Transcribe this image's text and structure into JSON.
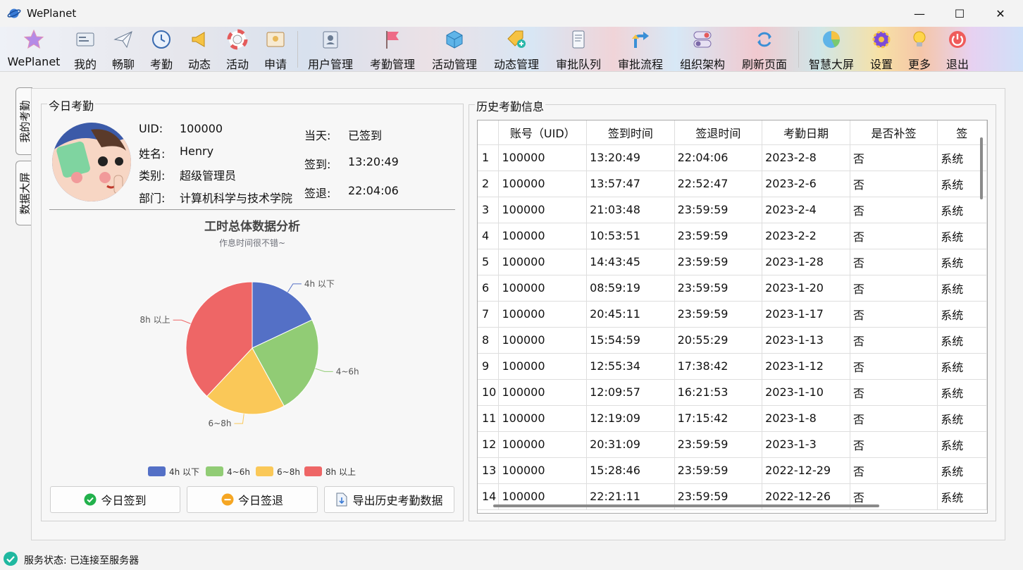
{
  "window": {
    "title": "WePlanet",
    "minimize_glyph": "—",
    "maximize_glyph": "☐",
    "close_glyph": "✕"
  },
  "toolbar": {
    "items": [
      {
        "label": "WePlanet",
        "icon": "star-icon"
      },
      {
        "label": "我的",
        "icon": "id-card-icon"
      },
      {
        "label": "畅聊",
        "icon": "paper-plane-icon"
      },
      {
        "label": "考勤",
        "icon": "clock-icon"
      },
      {
        "label": "动态",
        "icon": "megaphone-icon"
      },
      {
        "label": "活动",
        "icon": "lifebuoy-icon"
      },
      {
        "label": "申请",
        "icon": "certificate-icon"
      },
      {
        "label": "用户管理",
        "icon": "user-book-icon"
      },
      {
        "label": "考勤管理",
        "icon": "flag-icon"
      },
      {
        "label": "活动管理",
        "icon": "cube-icon"
      },
      {
        "label": "动态管理",
        "icon": "tag-plus-icon"
      },
      {
        "label": "审批队列",
        "icon": "scroll-icon"
      },
      {
        "label": "审批流程",
        "icon": "branch-arrow-icon"
      },
      {
        "label": "组织架构",
        "icon": "toggle-icon"
      },
      {
        "label": "刷新页面",
        "icon": "refresh-icon"
      },
      {
        "label": "智慧大屏",
        "icon": "dashboard-pie-icon"
      },
      {
        "label": "设置",
        "icon": "gear-icon"
      },
      {
        "label": "更多",
        "icon": "lightbulb-icon"
      },
      {
        "label": "退出",
        "icon": "power-icon"
      }
    ]
  },
  "side_tabs": [
    "我的考勤",
    "数据大屏"
  ],
  "today": {
    "group_title": "今日考勤",
    "uid_label": "UID:",
    "uid_value": "100000",
    "name_label": "姓名:",
    "name_value": "Henry",
    "type_label": "类别:",
    "type_value": "超级管理员",
    "dept_label": "部门:",
    "dept_value": "计算机科学与技术学院",
    "day_label": "当天:",
    "day_value": "已签到",
    "signin_label": "签到:",
    "signin_value": "13:20:49",
    "signout_label": "签退:",
    "signout_value": "22:04:06"
  },
  "chart_data": {
    "type": "pie",
    "title": "工时总体数据分析",
    "subtitle": "作息时间很不错~",
    "categories": [
      "4h 以下",
      "4~6h",
      "6~8h",
      "8h 以上"
    ],
    "values": [
      18,
      24,
      20,
      38
    ],
    "colors": [
      "#5470c6",
      "#91cc75",
      "#fac858",
      "#ee6666"
    ],
    "legend_position": "bottom"
  },
  "buttons": {
    "checkin": "今日签到",
    "checkout": "今日签退",
    "export": "导出历史考勤数据"
  },
  "history": {
    "group_title": "历史考勤信息",
    "columns": [
      "账号（UID）",
      "签到时间",
      "签退时间",
      "考勤日期",
      "是否补签",
      "签"
    ],
    "rows": [
      [
        "1",
        "100000",
        "13:20:49",
        "22:04:06",
        "2023-2-8",
        "否",
        "系统"
      ],
      [
        "2",
        "100000",
        "13:57:47",
        "22:52:47",
        "2023-2-6",
        "否",
        "系统"
      ],
      [
        "3",
        "100000",
        "21:03:48",
        "23:59:59",
        "2023-2-4",
        "否",
        "系统"
      ],
      [
        "4",
        "100000",
        "10:53:51",
        "23:59:59",
        "2023-2-2",
        "否",
        "系统"
      ],
      [
        "5",
        "100000",
        "14:43:45",
        "23:59:59",
        "2023-1-28",
        "否",
        "系统"
      ],
      [
        "6",
        "100000",
        "08:59:19",
        "23:59:59",
        "2023-1-20",
        "否",
        "系统"
      ],
      [
        "7",
        "100000",
        "20:45:11",
        "23:59:59",
        "2023-1-17",
        "否",
        "系统"
      ],
      [
        "8",
        "100000",
        "15:54:59",
        "20:55:29",
        "2023-1-13",
        "否",
        "系统"
      ],
      [
        "9",
        "100000",
        "12:55:34",
        "17:38:42",
        "2023-1-12",
        "否",
        "系统"
      ],
      [
        "10",
        "100000",
        "12:09:57",
        "16:21:53",
        "2023-1-10",
        "否",
        "系统"
      ],
      [
        "11",
        "100000",
        "12:19:09",
        "17:15:42",
        "2023-1-8",
        "否",
        "系统"
      ],
      [
        "12",
        "100000",
        "20:31:09",
        "23:59:59",
        "2023-1-3",
        "否",
        "系统"
      ],
      [
        "13",
        "100000",
        "15:28:46",
        "23:59:59",
        "2022-12-29",
        "否",
        "系统"
      ],
      [
        "14",
        "100000",
        "22:21:11",
        "23:59:59",
        "2022-12-26",
        "否",
        "系统"
      ]
    ]
  },
  "status": {
    "text": "服务状态: 已连接至服务器",
    "color": "#1fb8a0"
  }
}
